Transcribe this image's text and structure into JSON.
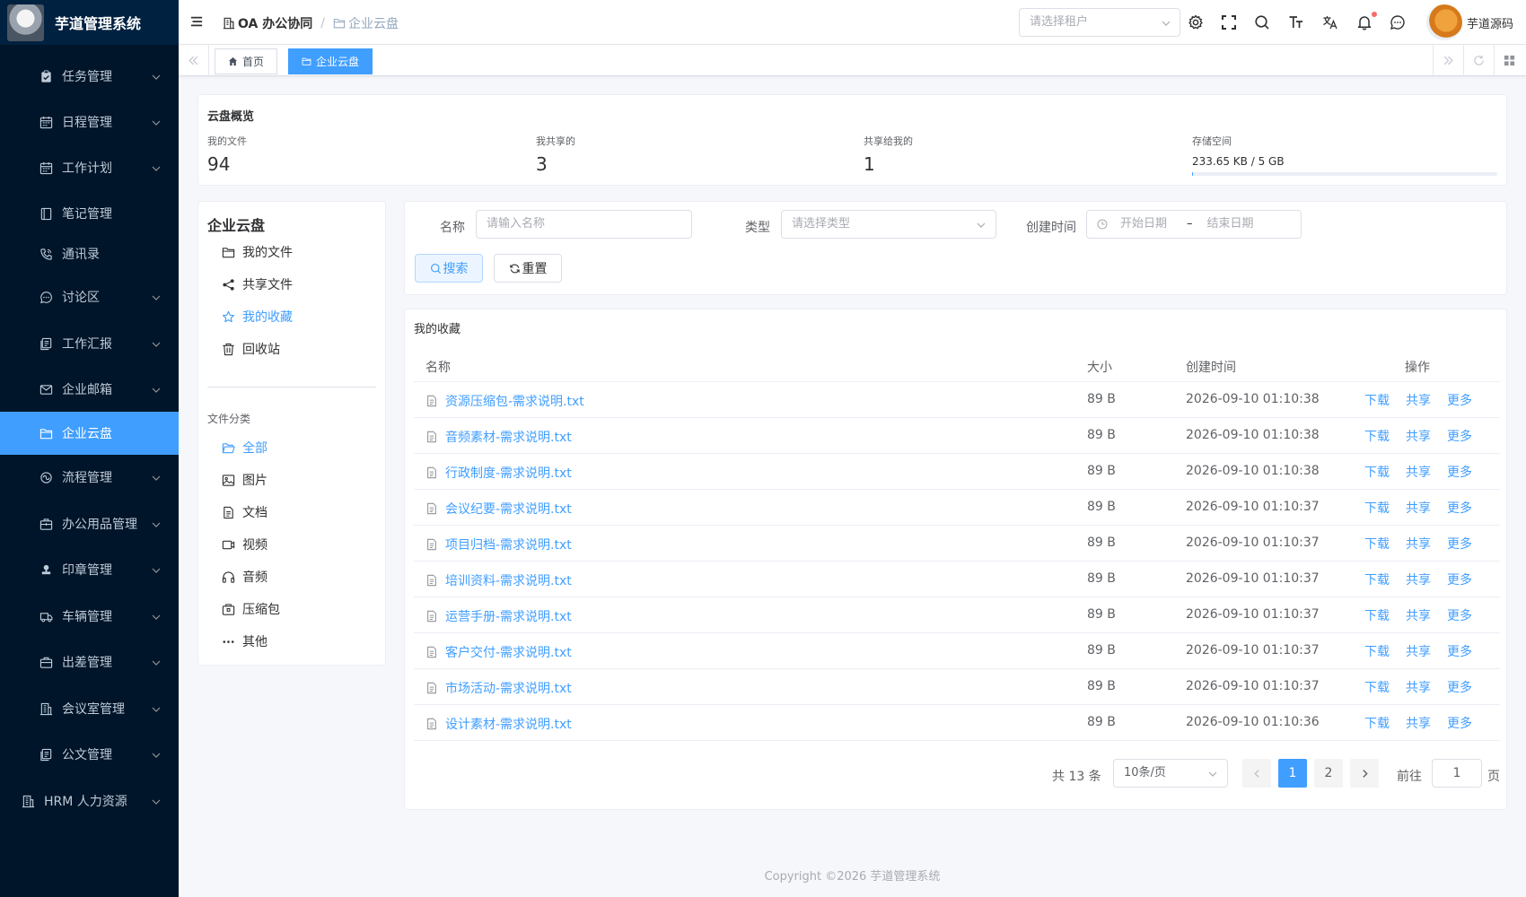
{
  "app": {
    "title": "芋道管理系统"
  },
  "sidebar": {
    "items": [
      {
        "label": "任务管理",
        "icon": "task-icon"
      },
      {
        "label": "日程管理",
        "icon": "calendar-icon"
      },
      {
        "label": "工作计划",
        "icon": "calendar-icon"
      },
      {
        "label": "笔记管理",
        "icon": "notebook-icon"
      },
      {
        "label": "通讯录",
        "icon": "phone-icon"
      },
      {
        "label": "讨论区",
        "icon": "chat-icon"
      },
      {
        "label": "工作汇报",
        "icon": "report-icon"
      },
      {
        "label": "企业邮箱",
        "icon": "mail-icon"
      },
      {
        "label": "企业云盘",
        "icon": "folder-icon",
        "active": true
      },
      {
        "label": "流程管理",
        "icon": "flow-icon"
      },
      {
        "label": "办公用品管理",
        "icon": "box-icon"
      },
      {
        "label": "印章管理",
        "icon": "stamp-icon"
      },
      {
        "label": "车辆管理",
        "icon": "car-icon"
      },
      {
        "label": "出差管理",
        "icon": "briefcase-icon"
      },
      {
        "label": "会议室管理",
        "icon": "building-icon"
      },
      {
        "label": "公文管理",
        "icon": "report-icon"
      },
      {
        "label": "HRM 人力资源",
        "icon": "building-icon"
      }
    ]
  },
  "header": {
    "breadcrumb": [
      "OA 办公协同",
      "/",
      "企业云盘"
    ],
    "tenant_placeholder": "请选择租户",
    "icons": [
      "settings-icon",
      "fullscreen-icon",
      "search-icon",
      "font-size-icon",
      "translate-icon",
      "bell-icon",
      "message-icon"
    ],
    "username": "芋道源码"
  },
  "tags": {
    "items": [
      "首页",
      "企业云盘"
    ]
  },
  "overview": {
    "title": "云盘概览",
    "stats": [
      {
        "label": "我的文件",
        "value": "94"
      },
      {
        "label": "我共享的",
        "value": "3"
      },
      {
        "label": "共享给我的",
        "value": "1"
      }
    ],
    "storage": {
      "label": "存储空间",
      "value": "233.65 KB / 5 GB",
      "used_fraction": 5e-05
    }
  },
  "tree": {
    "title": "企业云盘",
    "items": [
      {
        "label": "我的文件",
        "icon": "folder-icon"
      },
      {
        "label": "共享文件",
        "icon": "share-icon"
      },
      {
        "label": "我的收藏",
        "icon": "star-icon",
        "active": true
      },
      {
        "label": "回收站",
        "icon": "trash-icon"
      }
    ],
    "category_title": "文件分类",
    "categories": [
      {
        "label": "全部",
        "icon": "folder-open-icon",
        "active": true
      },
      {
        "label": "图片",
        "icon": "image-icon"
      },
      {
        "label": "文档",
        "icon": "document-icon"
      },
      {
        "label": "视频",
        "icon": "video-icon"
      },
      {
        "label": "音频",
        "icon": "headphones-icon"
      },
      {
        "label": "压缩包",
        "icon": "archive-icon"
      },
      {
        "label": "其他",
        "icon": "more-icon"
      }
    ]
  },
  "search": {
    "name_label": "名称",
    "name_placeholder": "请输入名称",
    "type_label": "类型",
    "type_placeholder": "请选择类型",
    "date_label": "创建时间",
    "date_start": "开始日期",
    "date_sep": "–",
    "date_end": "结束日期",
    "search_btn": "搜索",
    "reset_btn": "重置"
  },
  "table": {
    "title": "我的收藏",
    "columns": [
      "名称",
      "大小",
      "创建时间",
      "操作"
    ],
    "actions": [
      "下载",
      "共享",
      "更多"
    ],
    "rows": [
      {
        "name": "资源压缩包-需求说明.txt",
        "size": "89 B",
        "time": "2026-09-10 01:10:38"
      },
      {
        "name": "音频素材-需求说明.txt",
        "size": "89 B",
        "time": "2026-09-10 01:10:38"
      },
      {
        "name": "行政制度-需求说明.txt",
        "size": "89 B",
        "time": "2026-09-10 01:10:38"
      },
      {
        "name": "会议纪要-需求说明.txt",
        "size": "89 B",
        "time": "2026-09-10 01:10:37"
      },
      {
        "name": "项目归档-需求说明.txt",
        "size": "89 B",
        "time": "2026-09-10 01:10:37"
      },
      {
        "name": "培训资料-需求说明.txt",
        "size": "89 B",
        "time": "2026-09-10 01:10:37"
      },
      {
        "name": "运营手册-需求说明.txt",
        "size": "89 B",
        "time": "2026-09-10 01:10:37"
      },
      {
        "name": "客户交付-需求说明.txt",
        "size": "89 B",
        "time": "2026-09-10 01:10:37"
      },
      {
        "name": "市场活动-需求说明.txt",
        "size": "89 B",
        "time": "2026-09-10 01:10:37"
      },
      {
        "name": "设计素材-需求说明.txt",
        "size": "89 B",
        "time": "2026-09-10 01:10:36"
      }
    ]
  },
  "pagination": {
    "total_text": "共 13 条",
    "page_size": "10条/页",
    "pages": [
      "1",
      "2"
    ],
    "current": "1",
    "goto_label": "前往",
    "goto_value": "1",
    "page_suffix": "页"
  },
  "footer": {
    "text": "Copyright ©2026 芋道管理系统"
  },
  "colors": {
    "primary": "#409eff",
    "sidebar_bg": "#001529",
    "sidebar_text": "#bfcbd9"
  }
}
